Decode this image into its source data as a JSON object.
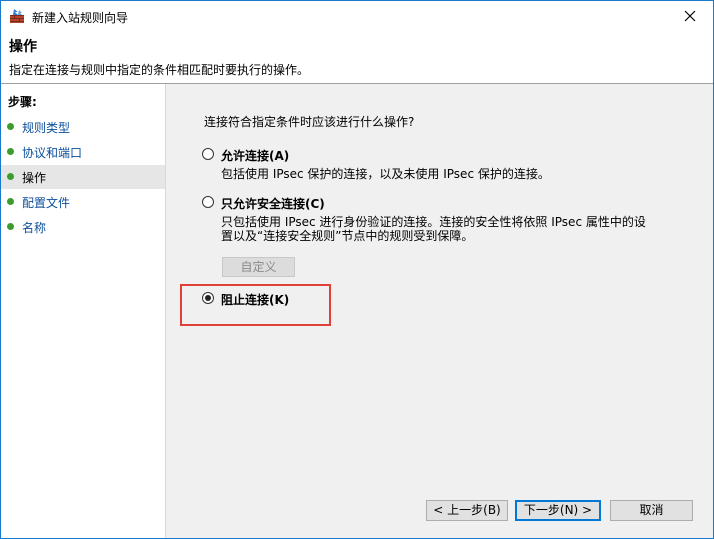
{
  "window": {
    "title": "新建入站规则向导",
    "close_glyph": "✕"
  },
  "header": {
    "title": "操作",
    "description": "指定在连接与规则中指定的条件相匹配时要执行的操作。"
  },
  "sidebar": {
    "steps_label": "步骤:",
    "items": [
      {
        "label": "规则类型",
        "active": false
      },
      {
        "label": "协议和端口",
        "active": false
      },
      {
        "label": "操作",
        "active": true
      },
      {
        "label": "配置文件",
        "active": false
      },
      {
        "label": "名称",
        "active": false
      }
    ]
  },
  "main": {
    "question": "连接符合指定条件时应该进行什么操作?",
    "options": [
      {
        "label": "允许连接(A)",
        "description": "包括使用 IPsec 保护的连接，以及未使用 IPsec 保护的连接。",
        "checked": false
      },
      {
        "label": "只允许安全连接(C)",
        "description_line1": "只包括使用 IPsec 进行身份验证的连接。连接的安全性将依照 IPsec 属性中的设",
        "description_line2": "置以及“连接安全规则”节点中的规则受到保障。",
        "checked": false
      },
      {
        "label": "阻止连接(K)",
        "checked": true
      }
    ],
    "custom_button": "自定义"
  },
  "footer": {
    "back": "< 上一步(B)",
    "next": "下一步(N) >",
    "cancel": "取消"
  },
  "colors": {
    "accent": "#0078d7",
    "highlight": "#e0403a",
    "step_dot": "#3a9d2c",
    "link": "#0b4f9c"
  }
}
